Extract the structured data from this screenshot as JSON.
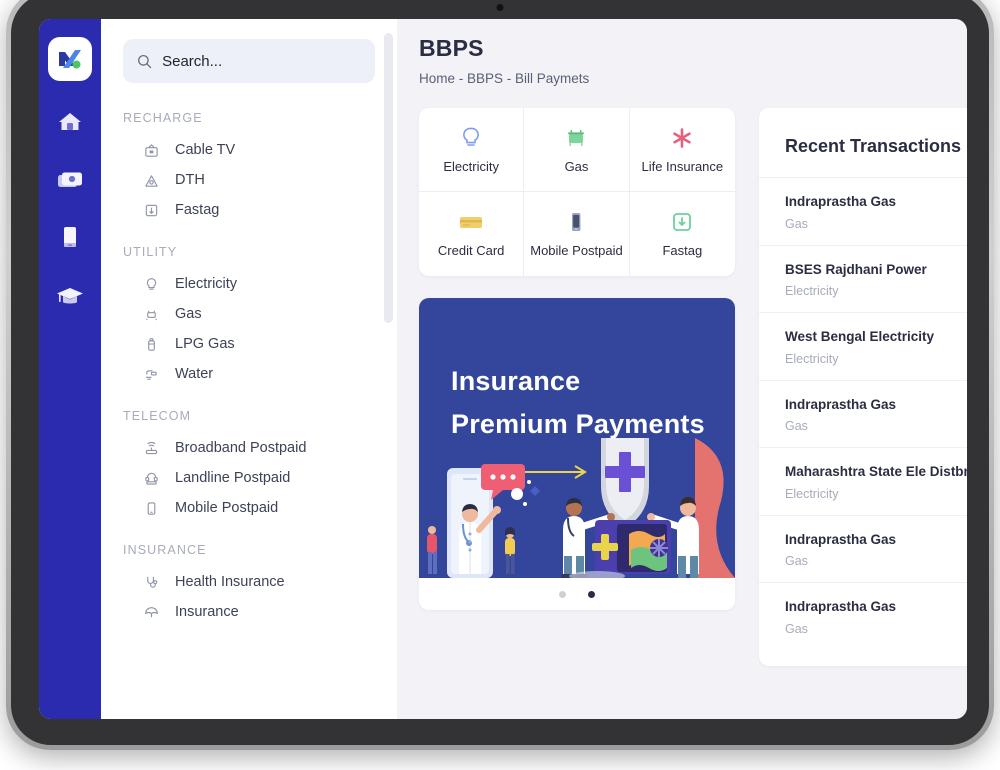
{
  "app": {
    "logo_icon": "nexus-n-logo-icon",
    "rail_icons": [
      {
        "name": "home-icon",
        "label": "Home"
      },
      {
        "name": "wallet-icon",
        "label": "Wallet"
      },
      {
        "name": "mobile-icon",
        "label": "Mobile"
      },
      {
        "name": "graduation-cap-icon",
        "label": "Education"
      }
    ]
  },
  "search": {
    "placeholder": "Search...",
    "value": "",
    "icon": "search-icon"
  },
  "menu": {
    "groups": [
      {
        "title": "RECHARGE",
        "items": [
          {
            "label": "Cable TV",
            "icon": "tv-icon"
          },
          {
            "label": "DTH",
            "icon": "satellite-dish-icon"
          },
          {
            "label": "Fastag",
            "icon": "fastag-icon"
          }
        ]
      },
      {
        "title": "UTILITY",
        "items": [
          {
            "label": "Electricity",
            "icon": "bulb-icon"
          },
          {
            "label": "Gas",
            "icon": "gas-icon"
          },
          {
            "label": "LPG Gas",
            "icon": "lpg-cylinder-icon"
          },
          {
            "label": "Water",
            "icon": "water-tap-icon"
          }
        ]
      },
      {
        "title": "TELECOM",
        "items": [
          {
            "label": "Broadband Postpaid",
            "icon": "router-icon"
          },
          {
            "label": "Landline Postpaid",
            "icon": "telephone-icon"
          },
          {
            "label": "Mobile Postpaid",
            "icon": "mobile-icon"
          }
        ]
      },
      {
        "title": "INSURANCE",
        "items": [
          {
            "label": "Health Insurance",
            "icon": "stethoscope-icon"
          },
          {
            "label": "Insurance",
            "icon": "umbrella-icon"
          }
        ]
      }
    ]
  },
  "header": {
    "title": "BBPS",
    "breadcrumb": "Home - BBPS - Bill Paymets"
  },
  "tiles": [
    {
      "label": "Electricity",
      "icon": "bulb-icon",
      "color": "#7e9bf0"
    },
    {
      "label": "Gas",
      "icon": "gas-stove-icon",
      "color": "#7fd69a"
    },
    {
      "label": "Life Insurance",
      "icon": "asterisk-star-icon",
      "color": "#e4607f"
    },
    {
      "label": "Credit Card",
      "icon": "credit-card-icon",
      "color": "#f0cd6d"
    },
    {
      "label": "Mobile Postpaid",
      "icon": "smartphone-icon",
      "color": "#6e7591"
    },
    {
      "label": "Fastag",
      "icon": "fastag-icon",
      "color": "#6ad29a"
    }
  ],
  "banner": {
    "line1": "Insurance",
    "line2": "Premium Payments",
    "background": "#33469b",
    "arrow_color": "#e8d44d",
    "dots": [
      {
        "state": "inactive"
      },
      {
        "state": "active"
      }
    ]
  },
  "recent": {
    "title": "Recent Transactions",
    "transactions": [
      {
        "name": "Indraprastha Gas",
        "type": "Gas"
      },
      {
        "name": "BSES Rajdhani Power",
        "type": "Electricity"
      },
      {
        "name": "West Bengal Electricity",
        "type": "Electricity"
      },
      {
        "name": "Indraprastha Gas",
        "type": "Gas"
      },
      {
        "name": "Maharashtra State Ele Distbn Co Ltd",
        "type": "Electricity"
      },
      {
        "name": "Indraprastha Gas",
        "type": "Gas"
      },
      {
        "name": "Indraprastha Gas",
        "type": "Gas"
      }
    ]
  },
  "colors": {
    "rail": "#2b2bb0",
    "page_bg": "#f2f2f7",
    "banner": "#33469b",
    "title": "#2b2d42"
  }
}
